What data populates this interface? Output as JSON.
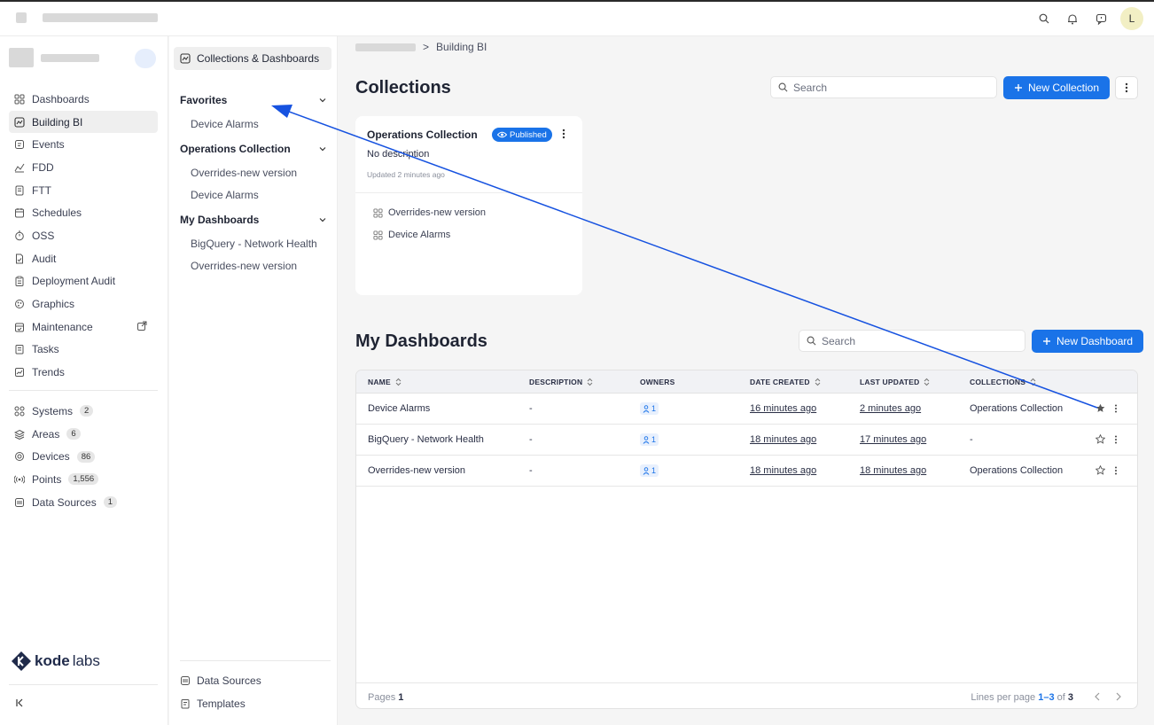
{
  "topbar": {
    "avatar_initial": "L",
    "icons": [
      "search-icon",
      "bell-icon",
      "chat-icon"
    ]
  },
  "sidebar": {
    "items": [
      {
        "label": "Dashboards",
        "icon": "grid-icon"
      },
      {
        "label": "Building BI",
        "icon": "chart-box-icon",
        "active": true
      },
      {
        "label": "Events",
        "icon": "events-icon"
      },
      {
        "label": "FDD",
        "icon": "fdd-icon"
      },
      {
        "label": "FTT",
        "icon": "ftt-icon"
      },
      {
        "label": "Schedules",
        "icon": "calendar-icon"
      },
      {
        "label": "OSS",
        "icon": "timer-icon"
      },
      {
        "label": "Audit",
        "icon": "audit-icon"
      },
      {
        "label": "Deployment Audit",
        "icon": "clipboard-icon"
      },
      {
        "label": "Graphics",
        "icon": "graphics-icon"
      },
      {
        "label": "Maintenance",
        "icon": "maintenance-icon",
        "external": true
      },
      {
        "label": "Tasks",
        "icon": "tasks-icon"
      },
      {
        "label": "Trends",
        "icon": "trends-icon"
      }
    ],
    "resources": [
      {
        "label": "Systems",
        "count": "2",
        "icon": "systems-icon"
      },
      {
        "label": "Areas",
        "count": "6",
        "icon": "layers-icon"
      },
      {
        "label": "Devices",
        "count": "86",
        "icon": "device-icon"
      },
      {
        "label": "Points",
        "count": "1,556",
        "icon": "signal-icon"
      },
      {
        "label": "Data Sources",
        "count": "1",
        "icon": "database-icon"
      }
    ],
    "logo_prefix": "kode",
    "logo_suffix": "labs"
  },
  "panel": {
    "header": "Collections & Dashboards",
    "groups": [
      {
        "title": "Favorites",
        "items": [
          "Device Alarms"
        ]
      },
      {
        "title": "Operations Collection",
        "items": [
          "Overrides-new version",
          "Device Alarms"
        ]
      },
      {
        "title": "My Dashboards",
        "items": [
          "BigQuery - Network Health",
          "Overrides-new version"
        ]
      }
    ],
    "footer": [
      {
        "label": "Data Sources",
        "icon": "database-icon"
      },
      {
        "label": "Templates",
        "icon": "template-icon"
      }
    ]
  },
  "breadcrumb": {
    "separator": ">",
    "current": "Building BI"
  },
  "collections": {
    "title": "Collections",
    "search_placeholder": "Search",
    "new_button": "New Collection",
    "card": {
      "title": "Operations Collection",
      "status": "Published",
      "description": "No description",
      "updated": "Updated 2 minutes ago",
      "items": [
        "Overrides-new version",
        "Device Alarms"
      ]
    }
  },
  "dashboards": {
    "title": "My Dashboards",
    "search_placeholder": "Search",
    "new_button": "New Dashboard",
    "columns": [
      "NAME",
      "DESCRIPTION",
      "OWNERS",
      "DATE CREATED",
      "LAST UPDATED",
      "COLLECTIONS"
    ],
    "rows": [
      {
        "name": "Device Alarms",
        "description": "-",
        "owners": "1",
        "created": "16 minutes ago",
        "updated": "2 minutes ago",
        "collection": "Operations Collection",
        "favorite": true
      },
      {
        "name": "BigQuery - Network Health",
        "description": "-",
        "owners": "1",
        "created": "18 minutes ago",
        "updated": "17 minutes ago",
        "collection": "-",
        "favorite": false
      },
      {
        "name": "Overrides-new version",
        "description": "-",
        "owners": "1",
        "created": "18 minutes ago",
        "updated": "18 minutes ago",
        "collection": "Operations Collection",
        "favorite": false
      }
    ],
    "footer": {
      "pages_label": "Pages",
      "pages_value": "1",
      "lines_label": "Lines per page",
      "lines_range": "1–3",
      "lines_of": "of",
      "lines_total": "3"
    }
  },
  "colors": {
    "accent": "#1a73e8",
    "annotation_arrow": "#1652e0"
  }
}
